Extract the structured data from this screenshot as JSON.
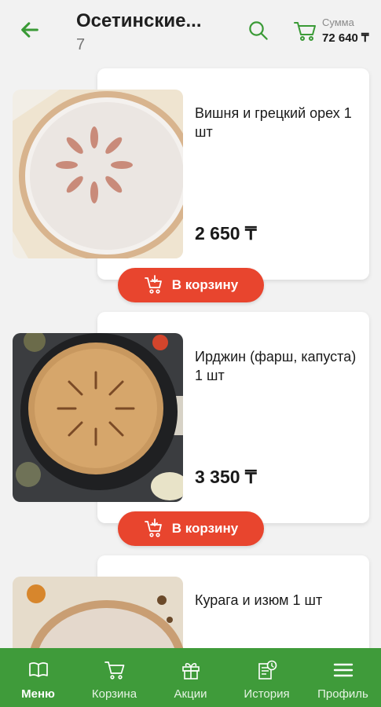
{
  "header": {
    "title": "Осетинские...",
    "count": "7",
    "sum_label": "Сумма",
    "sum_value": "72 640 ₸"
  },
  "products": [
    {
      "name": "Вишня и грецкий орех 1 шт",
      "price": "2 650 ₸",
      "button": "В корзину"
    },
    {
      "name": "Ирджин (фарш, капуста) 1 шт",
      "price": "3 350 ₸",
      "button": "В корзину"
    },
    {
      "name": "Курага и изюм 1 шт"
    }
  ],
  "nav": {
    "items": [
      {
        "label": "Меню",
        "icon": "book-icon"
      },
      {
        "label": "Корзина",
        "icon": "cart-icon"
      },
      {
        "label": "Акции",
        "icon": "gift-icon"
      },
      {
        "label": "История",
        "icon": "history-icon"
      },
      {
        "label": "Профиль",
        "icon": "menu-icon"
      }
    ],
    "active": "Меню"
  },
  "colors": {
    "brand_green": "#3f9b3a",
    "accent_red": "#e8452e",
    "header_icon_green": "#3a9a36"
  }
}
